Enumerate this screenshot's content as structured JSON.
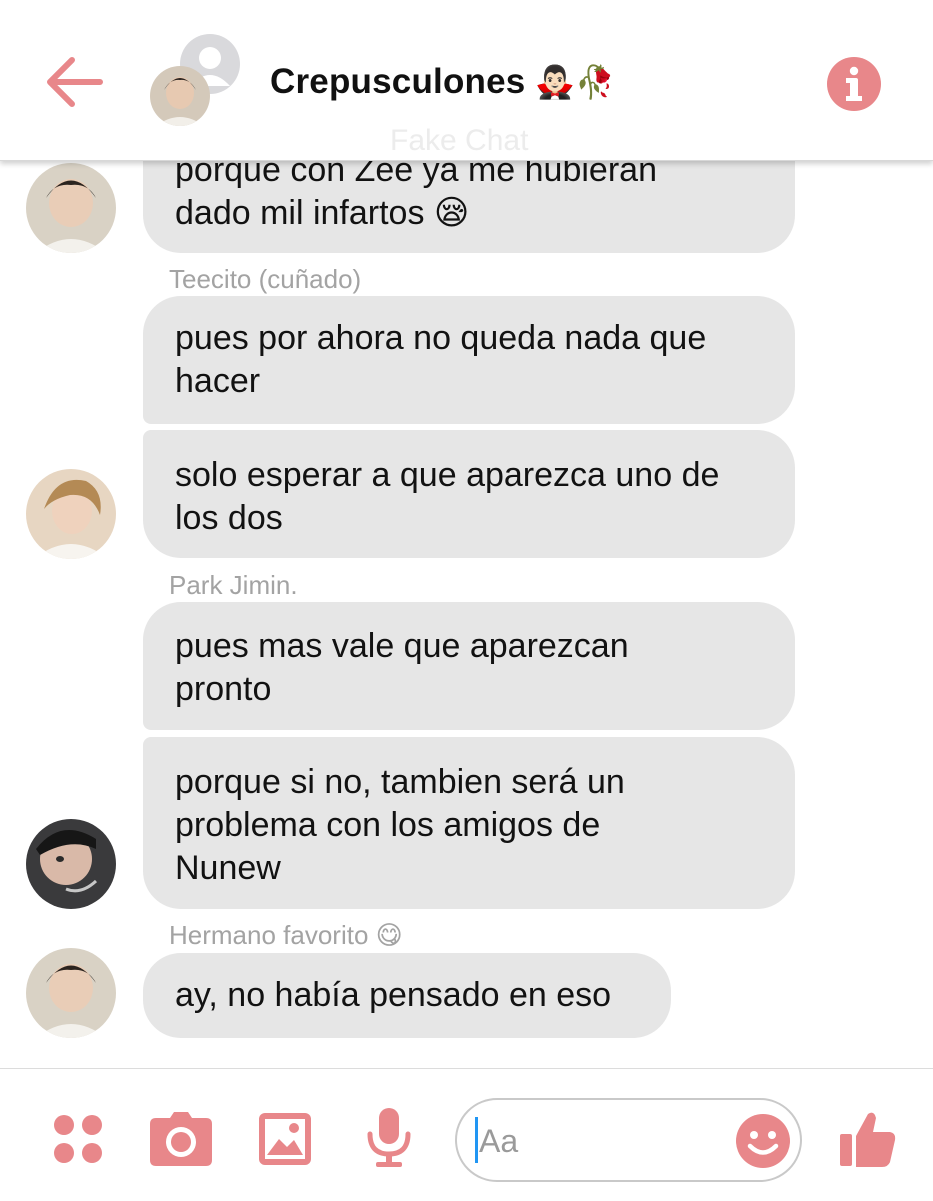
{
  "header": {
    "title": "Crepusculones",
    "title_emoji": "🧛🏻‍♂️🥀",
    "faded_subtitle": "Fake Chat"
  },
  "messages": [
    {
      "type": "bubble",
      "lines": [
        "porque con Zee ya me hubieran",
        "dado mil infartos 😪"
      ]
    },
    {
      "type": "sender",
      "name": "Teecito (cuñado)"
    },
    {
      "type": "bubble",
      "lines": [
        "pues por ahora no queda nada que",
        "hacer"
      ]
    },
    {
      "type": "bubble",
      "lines": [
        "solo esperar a que aparezca uno de",
        "los dos"
      ]
    },
    {
      "type": "sender",
      "name": "Park Jimin."
    },
    {
      "type": "bubble",
      "lines": [
        "pues mas vale que aparezcan",
        "pronto"
      ]
    },
    {
      "type": "bubble",
      "lines": [
        "porque si no, tambien será un",
        "problema con los amigos de",
        "Nunew"
      ]
    },
    {
      "type": "sender",
      "name": "Hermano favorito 😋"
    },
    {
      "type": "bubble",
      "lines": [
        "ay, no había pensado en eso"
      ]
    }
  ],
  "composer": {
    "placeholder": "Aa"
  },
  "colors": {
    "accent": "#e8878a",
    "bubble": "#e6e6e6",
    "sender_text": "#a3a3a3"
  },
  "icons": [
    "back-arrow-icon",
    "info-icon",
    "apps-icon",
    "camera-icon",
    "gallery-icon",
    "microphone-icon",
    "emoji-icon",
    "thumbs-up-icon"
  ]
}
